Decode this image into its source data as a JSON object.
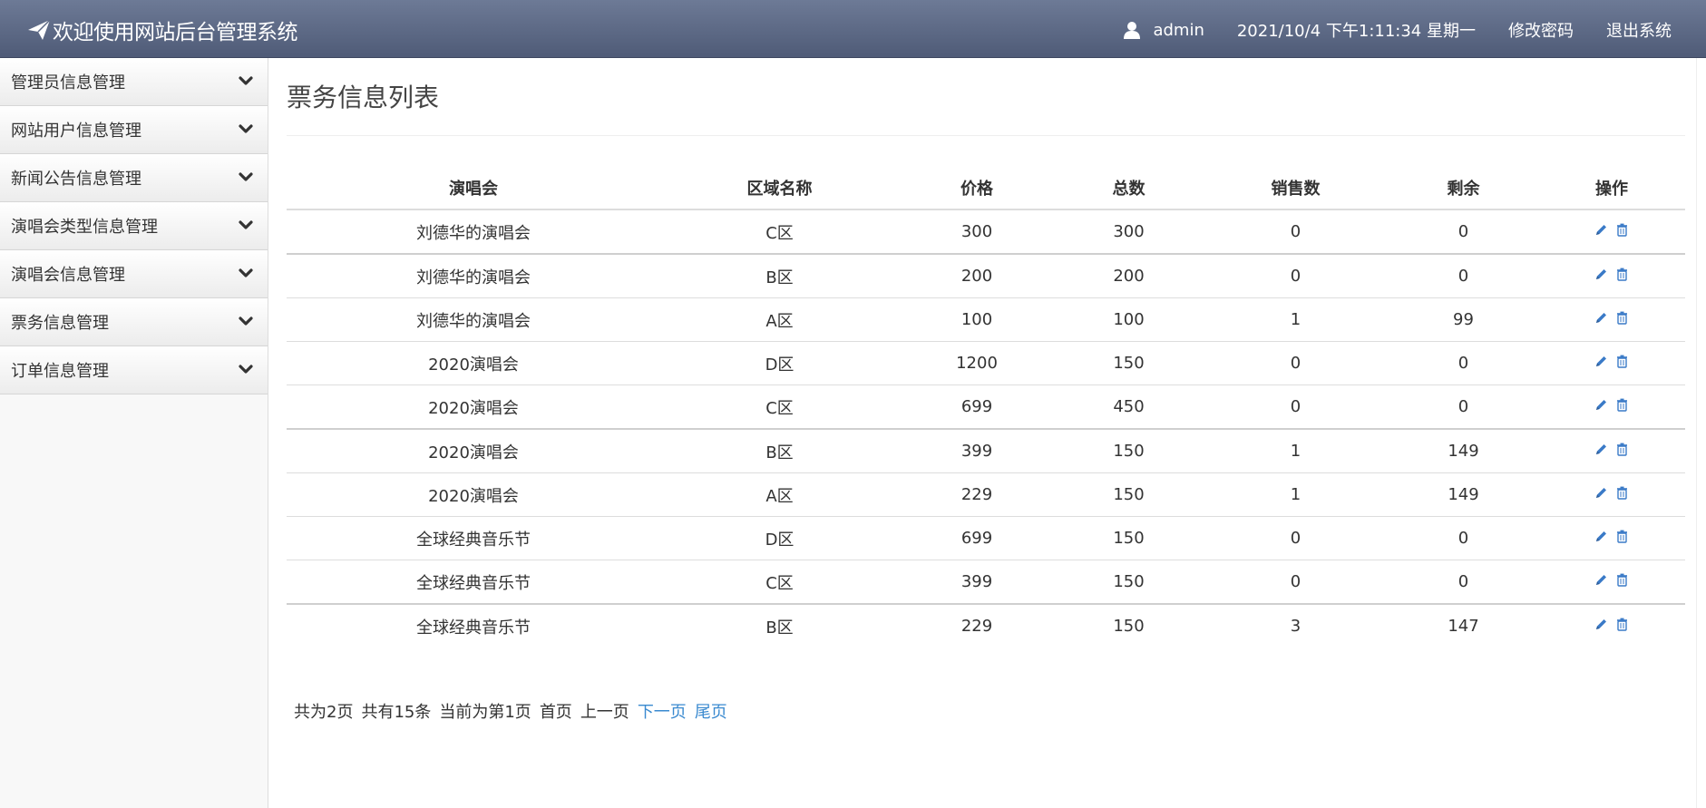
{
  "header": {
    "brand": "欢迎使用网站后台管理系统",
    "user": "admin",
    "datetime": "2021/10/4 下午1:11:34 星期一",
    "change_password": "修改密码",
    "logout": "退出系统"
  },
  "sidebar": {
    "items": [
      {
        "label": "管理员信息管理"
      },
      {
        "label": "网站用户信息管理"
      },
      {
        "label": "新闻公告信息管理"
      },
      {
        "label": "演唱会类型信息管理"
      },
      {
        "label": "演唱会信息管理"
      },
      {
        "label": "票务信息管理"
      },
      {
        "label": "订单信息管理"
      }
    ]
  },
  "main": {
    "title": "票务信息列表",
    "columns": [
      "演唱会",
      "区域名称",
      "价格",
      "总数",
      "销售数",
      "剩余",
      "操作"
    ],
    "rows": [
      [
        "刘德华的演唱会",
        "C区",
        "300",
        "300",
        "0",
        "0"
      ],
      [
        "刘德华的演唱会",
        "B区",
        "200",
        "200",
        "0",
        "0"
      ],
      [
        "刘德华的演唱会",
        "A区",
        "100",
        "100",
        "1",
        "99"
      ],
      [
        "2020演唱会",
        "D区",
        "1200",
        "150",
        "0",
        "0"
      ],
      [
        "2020演唱会",
        "C区",
        "699",
        "450",
        "0",
        "0"
      ],
      [
        "2020演唱会",
        "B区",
        "399",
        "150",
        "1",
        "149"
      ],
      [
        "2020演唱会",
        "A区",
        "229",
        "150",
        "1",
        "149"
      ],
      [
        "全球经典音乐节",
        "D区",
        "699",
        "150",
        "0",
        "0"
      ],
      [
        "全球经典音乐节",
        "C区",
        "399",
        "150",
        "0",
        "0"
      ],
      [
        "全球经典音乐节",
        "B区",
        "229",
        "150",
        "3",
        "147"
      ]
    ],
    "row_actions": [
      "edit-icon",
      "delete-icon"
    ]
  },
  "pager": {
    "total_pages": "共为2页",
    "total_items": "共有15条",
    "current": "当前为第1页",
    "first": "首页",
    "prev": "上一页",
    "next": "下一页",
    "last": "尾页"
  },
  "colors": {
    "header_top": "#6d7a96",
    "header_bottom": "#4f5b77",
    "link": "#3a8ad0",
    "icon": "#3a7ac7"
  }
}
